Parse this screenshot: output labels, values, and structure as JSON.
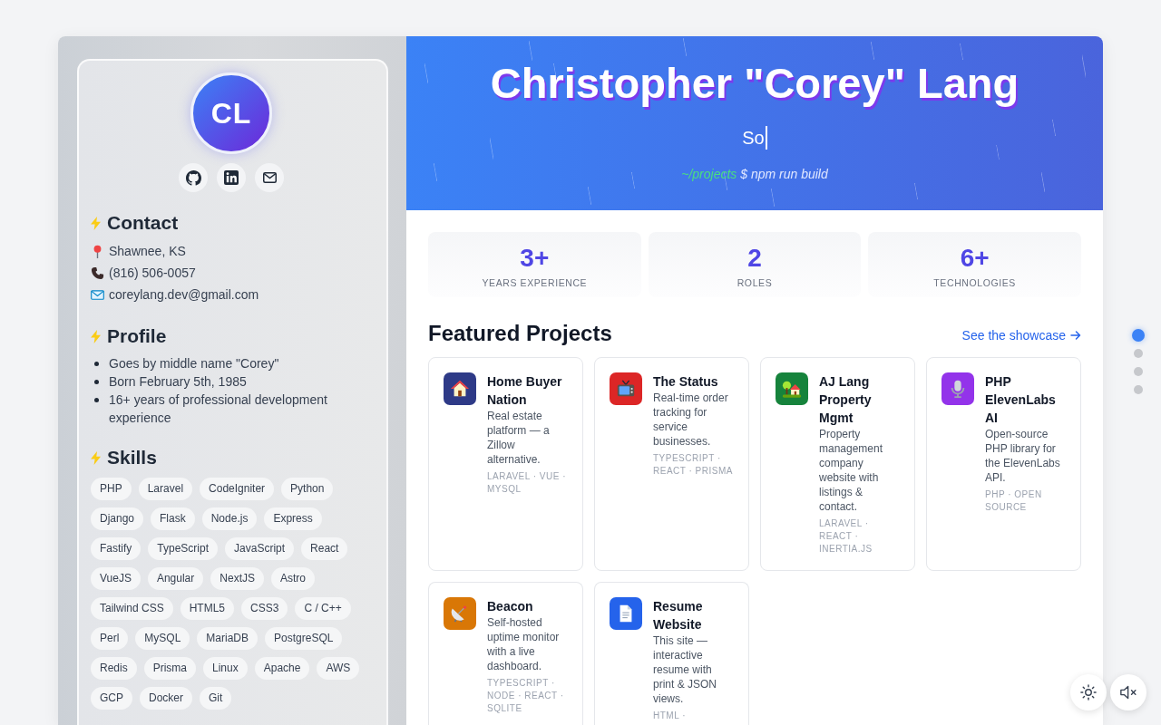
{
  "sidebar": {
    "avatar": {
      "initials": "CL"
    },
    "social_links": [
      {
        "kind": "github"
      },
      {
        "kind": "linkedin"
      },
      {
        "kind": "email"
      }
    ],
    "contact": {
      "title": "Contact",
      "items": [
        {
          "kind": "location",
          "text": "Shawnee, KS"
        },
        {
          "kind": "phone",
          "text": "(816) 506-0057"
        },
        {
          "kind": "email",
          "text": "coreylang.dev@gmail.com"
        }
      ]
    },
    "profile": {
      "title": "Profile",
      "items": [
        "Goes by middle name \"Corey\"",
        "Born February 5th, 1985",
        "16+ years of professional development experience"
      ]
    },
    "skills": {
      "title": "Skills",
      "items": [
        "PHP",
        "Laravel",
        "CodeIgniter",
        "Python",
        "Django",
        "Flask",
        "Node.js",
        "Express",
        "Fastify",
        "TypeScript",
        "JavaScript",
        "React",
        "VueJS",
        "Angular",
        "NextJS",
        "Astro",
        "Tailwind CSS",
        "HTML5",
        "CSS3",
        "C / C++",
        "Perl",
        "MySQL",
        "MariaDB",
        "PostgreSQL",
        "Redis",
        "Prisma",
        "Linux",
        "Apache",
        "AWS",
        "GCP",
        "Docker",
        "Git"
      ]
    }
  },
  "header": {
    "name": "Christopher \"Corey\" Lang",
    "typed_text": "So",
    "terminal": {
      "path": "~/projects",
      "command": "$ npm run build"
    }
  },
  "stats": [
    {
      "value": "3+",
      "label": "YEARS EXPERIENCE"
    },
    {
      "value": "2",
      "label": "ROLES"
    },
    {
      "value": "6+",
      "label": "TECHNOLOGIES"
    }
  ],
  "projects": {
    "title": "Featured Projects",
    "link": "See the showcase",
    "items": [
      {
        "kind": "house",
        "color": "#2e3a87",
        "title": "Home Buyer Nation",
        "description": "Real estate platform — a Zillow alternative.",
        "tags": "LARAVEL · VUE · MYSQL"
      },
      {
        "kind": "television",
        "color": "#dc2626",
        "title": "The Status",
        "description": "Real-time order tracking for service businesses.",
        "tags": "TYPESCRIPT · REACT · PRISMA"
      },
      {
        "kind": "house_garden",
        "color": "#16833c",
        "title": "AJ Lang Property Mgmt",
        "description": "Property management company website with listings & contact.",
        "tags": "LARAVEL · REACT · INERTIA.JS"
      },
      {
        "kind": "microphone",
        "color": "#9333ea",
        "title": "PHP ElevenLabs AI",
        "description": "Open-source PHP library for the ElevenLabs API.",
        "tags": "PHP · OPEN SOURCE"
      },
      {
        "kind": "satellite_dish",
        "color": "#d97706",
        "title": "Beacon",
        "description": "Self-hosted uptime monitor with a live dashboard.",
        "tags": "TYPESCRIPT · NODE · REACT · SQLITE"
      },
      {
        "kind": "document",
        "color": "#2563eb",
        "title": "Resume Website",
        "description": "This site — interactive resume with print & JSON views.",
        "tags": "HTML ·"
      }
    ]
  },
  "section_nav": [
    {
      "selected": true
    },
    {
      "selected": false
    },
    {
      "selected": false
    },
    {
      "selected": false
    }
  ],
  "theme_toggle": {
    "dark_mode": false
  },
  "sound_toggle": {
    "muted": true
  }
}
